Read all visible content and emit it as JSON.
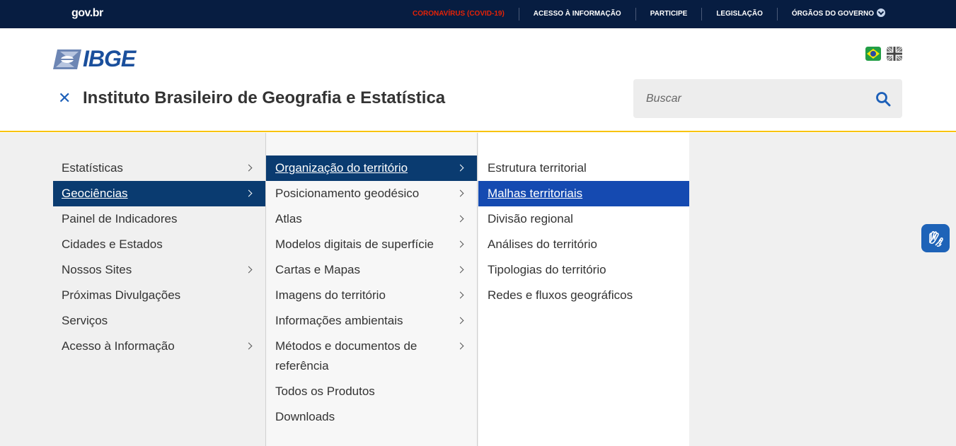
{
  "govbar": {
    "logo": "gov.br",
    "links": [
      "CORONAVÍRUS (COVID-19)",
      "ACESSO À INFORMAÇÃO",
      "PARTICIPE",
      "LEGISLAÇÃO",
      "ÓRGÃOS DO GOVERNO"
    ],
    "covid_color": "#e52207"
  },
  "header": {
    "logo_text": "IBGE",
    "title": "Instituto Brasileiro de Geografia e Estatística",
    "close_icon": "close-icon",
    "search": {
      "placeholder": "Buscar",
      "icon": "search-icon"
    },
    "languages": [
      "pt-br-flag-icon",
      "en-uk-flag-icon"
    ],
    "accent": "#f8c300"
  },
  "menu": {
    "col1": [
      {
        "label": "Estatísticas",
        "has_sub": true
      },
      {
        "label": "Geociências",
        "has_sub": true,
        "active": true
      },
      {
        "label": "Painel de Indicadores",
        "has_sub": false
      },
      {
        "label": "Cidades e Estados",
        "has_sub": false
      },
      {
        "label": "Nossos Sites",
        "has_sub": true
      },
      {
        "label": "Próximas Divulgações",
        "has_sub": false
      },
      {
        "label": "Serviços",
        "has_sub": false
      },
      {
        "label": "Acesso à Informação",
        "has_sub": true
      }
    ],
    "col2": [
      {
        "label": "Organização do território",
        "has_sub": true,
        "active": true
      },
      {
        "label": "Posicionamento geodésico",
        "has_sub": true
      },
      {
        "label": "Atlas",
        "has_sub": true
      },
      {
        "label": "Modelos digitais de superfície",
        "has_sub": true
      },
      {
        "label": "Cartas e Mapas",
        "has_sub": true
      },
      {
        "label": "Imagens do território",
        "has_sub": true
      },
      {
        "label": "Informações ambientais",
        "has_sub": true
      },
      {
        "label": "Métodos e documentos de referência",
        "has_sub": true
      },
      {
        "label": "Todos os Produtos",
        "has_sub": false
      },
      {
        "label": "Downloads",
        "has_sub": false
      }
    ],
    "col3": [
      {
        "label": "Estrutura territorial"
      },
      {
        "label": "Malhas territoriais",
        "active": true
      },
      {
        "label": "Divisão regional"
      },
      {
        "label": "Análises do território"
      },
      {
        "label": "Tipologias do território"
      },
      {
        "label": "Redes e fluxos geográficos"
      }
    ],
    "active_color": "#0a3b70",
    "highlight_color": "#154ab1"
  },
  "accessibility": {
    "icon": "vlibras-hands-icon"
  }
}
